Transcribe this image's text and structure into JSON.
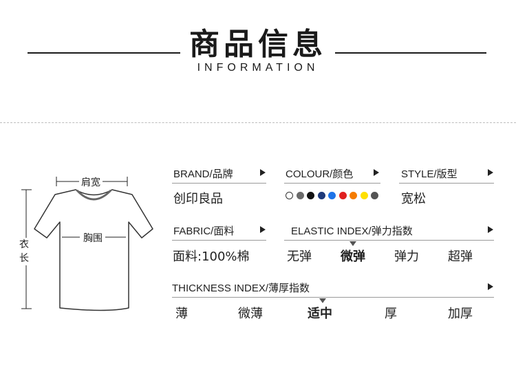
{
  "header": {
    "title": "商品信息",
    "subtitle": "INFORMATION"
  },
  "diagram": {
    "shoulder": "肩宽",
    "chest": "胸围",
    "length_chars": [
      "衣",
      "长"
    ]
  },
  "specs": {
    "brand": {
      "label": "BRAND/品牌",
      "value": "创印良品"
    },
    "colour": {
      "label": "COLOUR/颜色",
      "swatches": [
        "#ffffff",
        "#6b6b6b",
        "#111111",
        "#1f3a7a",
        "#1e73e8",
        "#e02020",
        "#f57c00",
        "#ffe000",
        "#555555"
      ]
    },
    "style": {
      "label": "STYLE/版型",
      "value": "宽松"
    },
    "fabric": {
      "label": "FABRIC/面料",
      "value": "面料:100%棉"
    },
    "elastic": {
      "label": "ELASTIC INDEX/弹力指数",
      "options": [
        "无弹",
        "微弹",
        "弹力",
        "超弹"
      ],
      "selected": "微弹"
    },
    "thickness": {
      "label": "THICKNESS INDEX/薄厚指数",
      "options": [
        "薄",
        "微薄",
        "适中",
        "厚",
        "加厚"
      ],
      "selected": "适中"
    }
  }
}
